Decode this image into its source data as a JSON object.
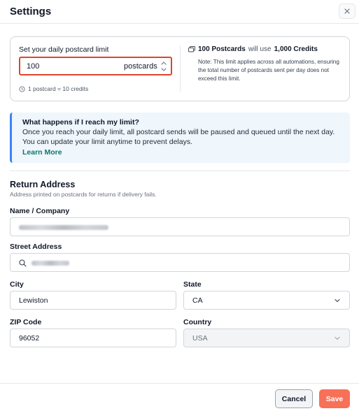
{
  "dialog": {
    "title": "Settings"
  },
  "limit": {
    "label": "Set your daily postcard limit",
    "value": "100",
    "unit": "postcards",
    "credit_note": "1 postcard = 10 credits",
    "summary_count": "100 Postcards",
    "summary_mid": "will use",
    "summary_credits": "1,000 Credits",
    "summary_note": "Note: This limit applies across all automations, ensuring the total number of postcards sent per day does not exceed this limit."
  },
  "info": {
    "title": "What happens if I reach my limit?",
    "body": "Once you reach your daily limit, all postcard sends will be paused and queued until the next day. You can update your limit anytime to prevent delays.",
    "link": "Learn More"
  },
  "return_address": {
    "title": "Return Address",
    "subtitle": "Address printed on postcards for returns if delivery fails.",
    "name_label": "Name / Company",
    "street_label": "Street Address",
    "city_label": "City",
    "city_value": "Lewiston",
    "state_label": "State",
    "state_value": "CA",
    "zip_label": "ZIP Code",
    "zip_value": "96052",
    "country_label": "Country",
    "country_value": "USA"
  },
  "footer": {
    "cancel": "Cancel",
    "save": "Save"
  },
  "colors": {
    "accent": "#f87058",
    "highlight_border": "#e0452b",
    "info_bg": "#eff6fc",
    "link": "#0f766e"
  },
  "icons": {
    "close": "close-icon",
    "postcard": "postcard-icon",
    "clock": "clock-icon",
    "search": "search-icon",
    "chevron": "chevron-down-icon",
    "stepper": "stepper-icon"
  }
}
